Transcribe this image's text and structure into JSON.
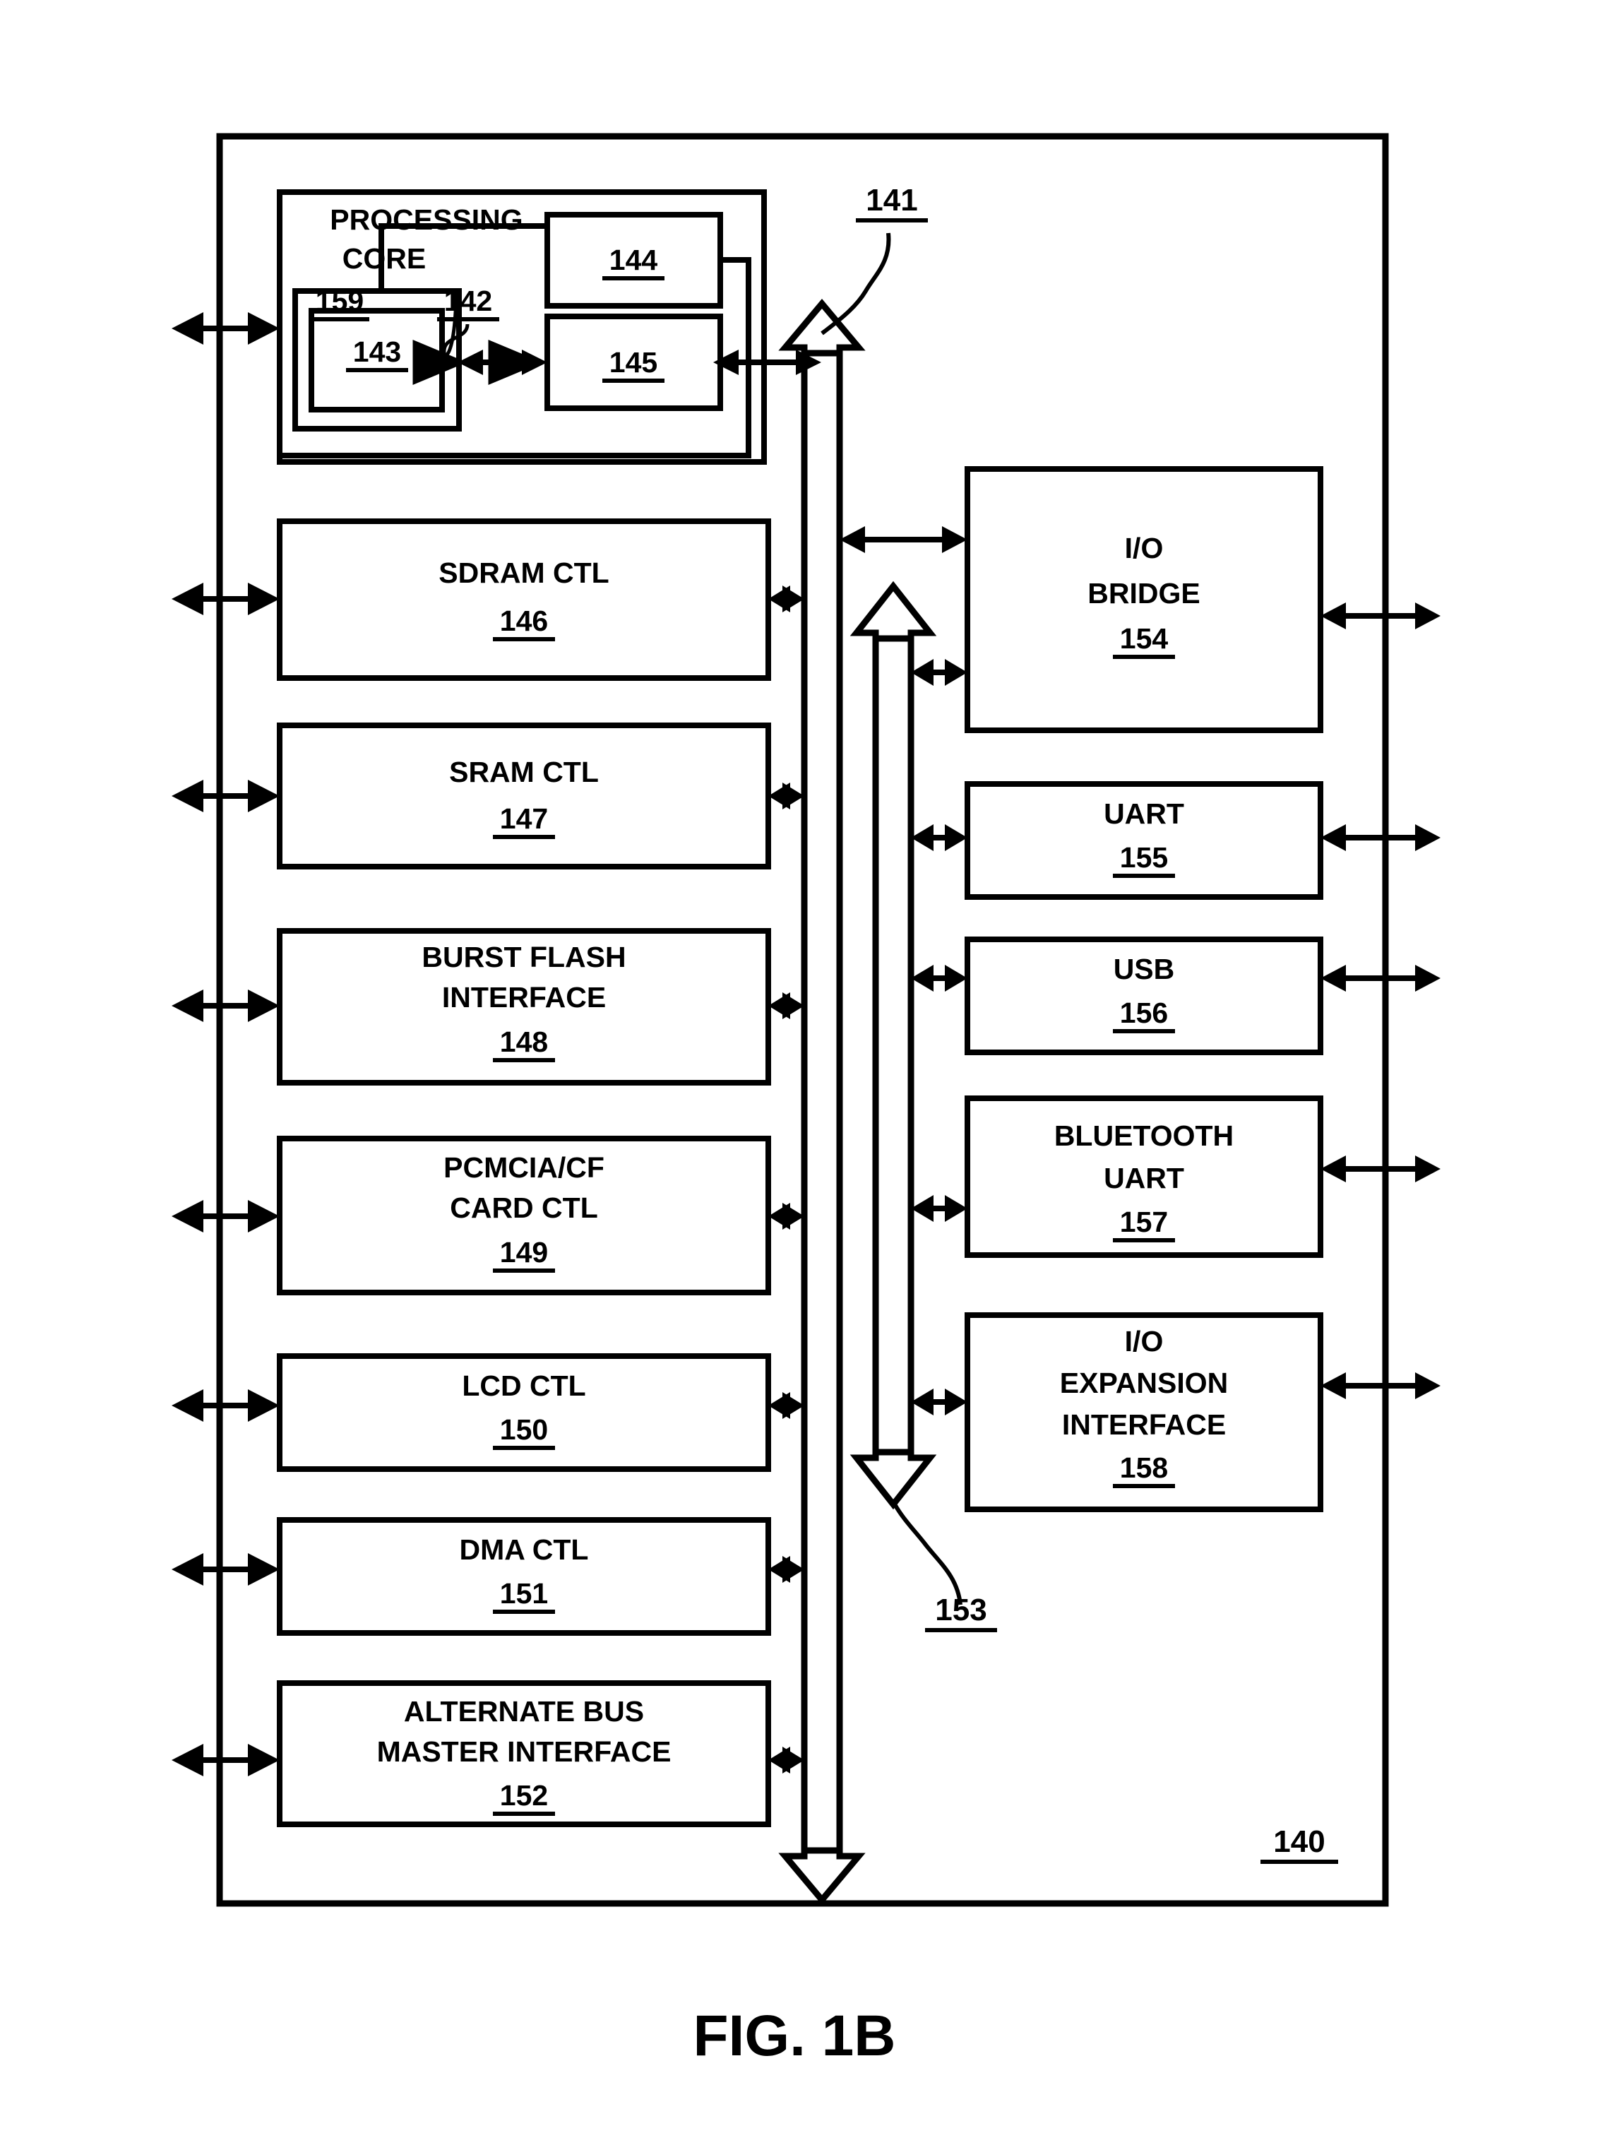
{
  "figure": {
    "caption": "FIG. 1B",
    "outer_ref": "140",
    "bus_main_ref": "141",
    "bus_io_ref": "153"
  },
  "processing_core": {
    "title_line1": "PROCESSING",
    "title_line2": "CORE",
    "ref": "159",
    "sub_ref_142": "142",
    "unit_143": "143",
    "unit_144": "144",
    "unit_145": "145"
  },
  "left_blocks": [
    {
      "lines": [
        "SDRAM CTL"
      ],
      "ref": "146"
    },
    {
      "lines": [
        "SRAM CTL"
      ],
      "ref": "147"
    },
    {
      "lines": [
        "BURST FLASH",
        "INTERFACE"
      ],
      "ref": "148"
    },
    {
      "lines": [
        "PCMCIA/CF",
        "CARD CTL"
      ],
      "ref": "149"
    },
    {
      "lines": [
        "LCD CTL"
      ],
      "ref": "150"
    },
    {
      "lines": [
        "DMA CTL"
      ],
      "ref": "151"
    },
    {
      "lines": [
        "ALTERNATE BUS",
        "MASTER INTERFACE"
      ],
      "ref": "152"
    }
  ],
  "right_blocks": [
    {
      "lines": [
        "I/O",
        "BRIDGE"
      ],
      "ref": "154"
    },
    {
      "lines": [
        "UART"
      ],
      "ref": "155"
    },
    {
      "lines": [
        "USB"
      ],
      "ref": "156"
    },
    {
      "lines": [
        "BLUETOOTH",
        "UART"
      ],
      "ref": "157"
    },
    {
      "lines": [
        "I/O",
        "EXPANSION",
        "INTERFACE"
      ],
      "ref": "158"
    }
  ],
  "colors": {
    "stroke": "#000000",
    "background": "#ffffff"
  }
}
